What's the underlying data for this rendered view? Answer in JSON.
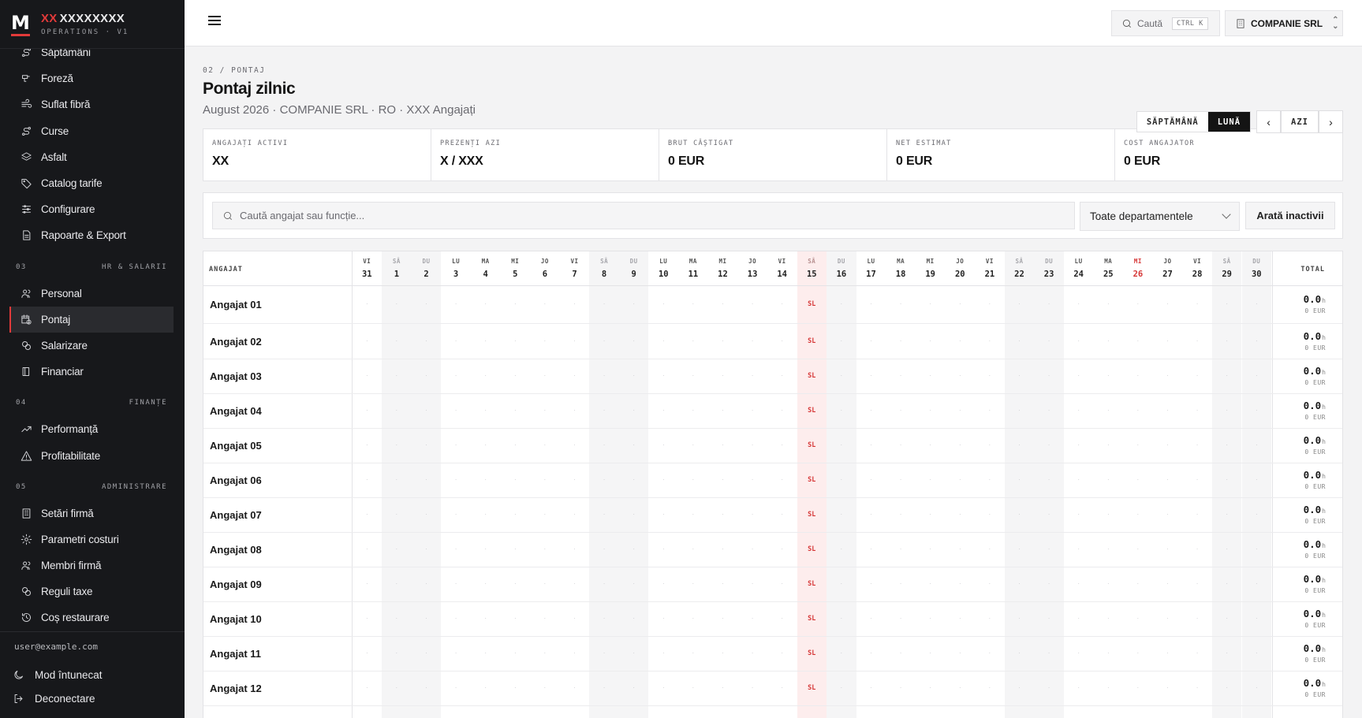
{
  "brand": {
    "prefix": "XX",
    "name": "XXXXXXXX",
    "subtitle": "OPERATIONS · V1",
    "logo_letter": "M"
  },
  "sidebar": {
    "items_top": [
      {
        "label": "Săptămâni",
        "icon": "route-icon"
      },
      {
        "label": "Foreză",
        "icon": "drill-icon"
      },
      {
        "label": "Suflat fibră",
        "icon": "wind-icon"
      },
      {
        "label": "Curse",
        "icon": "route-icon"
      },
      {
        "label": "Asfalt",
        "icon": "layers-icon"
      },
      {
        "label": "Catalog tarife",
        "icon": "tag-icon"
      },
      {
        "label": "Configurare",
        "icon": "sliders-icon"
      },
      {
        "label": "Rapoarte & Export",
        "icon": "file-icon"
      }
    ],
    "section_hr": {
      "num": "03",
      "title": "HR & SALARII"
    },
    "items_hr": [
      {
        "label": "Personal",
        "icon": "users-icon"
      },
      {
        "label": "Pontaj",
        "icon": "calendar-clock-icon",
        "active": true
      },
      {
        "label": "Salarizare",
        "icon": "coins-icon"
      },
      {
        "label": "Financiar",
        "icon": "book-icon"
      }
    ],
    "section_fin": {
      "num": "04",
      "title": "FINANȚE"
    },
    "items_fin": [
      {
        "label": "Performanță",
        "icon": "trend-icon"
      },
      {
        "label": "Profitabilitate",
        "icon": "warning-icon"
      }
    ],
    "section_admin": {
      "num": "05",
      "title": "ADMINISTRARE"
    },
    "items_admin": [
      {
        "label": "Setări firmă",
        "icon": "building-icon"
      },
      {
        "label": "Parametri costuri",
        "icon": "gear-icon"
      },
      {
        "label": "Membri firmă",
        "icon": "users-icon"
      },
      {
        "label": "Reguli taxe",
        "icon": "coins-icon"
      },
      {
        "label": "Coș restaurare",
        "icon": "restore-icon"
      }
    ],
    "footer": {
      "email": "user@example.com",
      "dark_mode": "Mod întunecat",
      "logout": "Deconectare"
    }
  },
  "topbar": {
    "search_label": "Caută",
    "search_kbd": "CTRL K",
    "company": "COMPANIE SRL"
  },
  "header": {
    "breadcrumb": "02 / PONTAJ",
    "title": "Pontaj zilnic",
    "subtitle": "August 2026 · COMPANIE SRL · RO · XXX Angajați",
    "view_week": "SĂPTĂMÂNĂ",
    "view_month": "LUNĂ",
    "prev": "‹",
    "next": "›",
    "today": "AZI"
  },
  "stats": [
    {
      "label": "ANGAJAȚI ACTIVI",
      "value": "XX"
    },
    {
      "label": "PREZENȚI AZI",
      "value": "X / XXX"
    },
    {
      "label": "BRUT CÂȘTIGAT",
      "value": "0 EUR"
    },
    {
      "label": "NET ESTIMAT",
      "value": "0 EUR"
    },
    {
      "label": "COST ANGAJATOR",
      "value": "0 EUR"
    }
  ],
  "filters": {
    "search_placeholder": "Caută angajat sau funcție...",
    "department": "Toate departamentele",
    "show_inactive": "Arată inactivii"
  },
  "table": {
    "col_employee": "ANGAJAT",
    "col_total": "TOTAL",
    "empty_mark": "·",
    "holiday_mark": "SL",
    "hours_unit": "h",
    "days": [
      {
        "w": "VI",
        "n": "31"
      },
      {
        "w": "SÂ",
        "n": "1",
        "weekend": true
      },
      {
        "w": "DU",
        "n": "2",
        "weekend": true
      },
      {
        "w": "LU",
        "n": "3"
      },
      {
        "w": "MA",
        "n": "4"
      },
      {
        "w": "MI",
        "n": "5"
      },
      {
        "w": "JO",
        "n": "6"
      },
      {
        "w": "VI",
        "n": "7"
      },
      {
        "w": "SÂ",
        "n": "8",
        "weekend": true
      },
      {
        "w": "DU",
        "n": "9",
        "weekend": true
      },
      {
        "w": "LU",
        "n": "10"
      },
      {
        "w": "MA",
        "n": "11"
      },
      {
        "w": "MI",
        "n": "12"
      },
      {
        "w": "JO",
        "n": "13"
      },
      {
        "w": "VI",
        "n": "14"
      },
      {
        "w": "SÂ",
        "n": "15",
        "holiday": true
      },
      {
        "w": "DU",
        "n": "16",
        "weekend": true
      },
      {
        "w": "LU",
        "n": "17"
      },
      {
        "w": "MA",
        "n": "18"
      },
      {
        "w": "MI",
        "n": "19"
      },
      {
        "w": "JO",
        "n": "20"
      },
      {
        "w": "VI",
        "n": "21"
      },
      {
        "w": "SÂ",
        "n": "22",
        "weekend": true
      },
      {
        "w": "DU",
        "n": "23",
        "weekend": true
      },
      {
        "w": "LU",
        "n": "24"
      },
      {
        "w": "MA",
        "n": "25"
      },
      {
        "w": "MI",
        "n": "26",
        "today": true
      },
      {
        "w": "JO",
        "n": "27"
      },
      {
        "w": "VI",
        "n": "28"
      },
      {
        "w": "SÂ",
        "n": "29",
        "weekend": true
      },
      {
        "w": "DU",
        "n": "30",
        "weekend": true
      }
    ],
    "rows": [
      {
        "name": "Angajat 01",
        "hours": "0.0",
        "cost": "0 EUR"
      },
      {
        "name": "Angajat 02",
        "hours": "0.0",
        "cost": "0 EUR"
      },
      {
        "name": "Angajat 03",
        "hours": "0.0",
        "cost": "0 EUR"
      },
      {
        "name": "Angajat 04",
        "hours": "0.0",
        "cost": "0 EUR"
      },
      {
        "name": "Angajat 05",
        "hours": "0.0",
        "cost": "0 EUR"
      },
      {
        "name": "Angajat 06",
        "hours": "0.0",
        "cost": "0 EUR"
      },
      {
        "name": "Angajat 07",
        "hours": "0.0",
        "cost": "0 EUR"
      },
      {
        "name": "Angajat 08",
        "hours": "0.0",
        "cost": "0 EUR"
      },
      {
        "name": "Angajat 09",
        "hours": "0.0",
        "cost": "0 EUR"
      },
      {
        "name": "Angajat 10",
        "hours": "0.0",
        "cost": "0 EUR"
      },
      {
        "name": "Angajat 11",
        "hours": "0.0",
        "cost": "0 EUR"
      },
      {
        "name": "Angajat 12",
        "hours": "0.0",
        "cost": "0 EUR"
      }
    ]
  }
}
